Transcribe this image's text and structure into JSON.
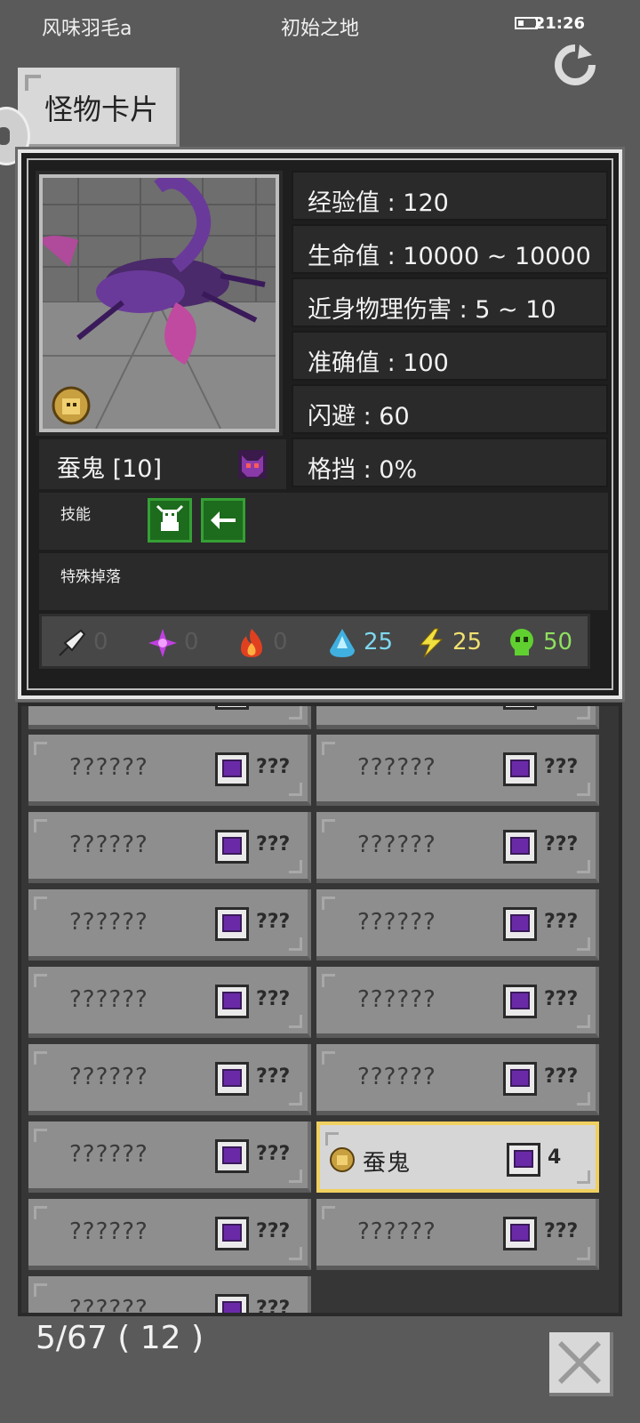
{
  "status": {
    "carrier": "风味羽毛a",
    "location": "初始之地",
    "time": "21:26"
  },
  "tab": {
    "label": "怪物卡片"
  },
  "monster": {
    "name": "蚕鬼 [10]",
    "stats": [
      "经验值 : 120",
      "生命值 : 10000 ~ 10000",
      "近身物理伤害 : 5 ~ 10",
      "准确值 : 100",
      "闪避 : 60",
      "格挡 : 0%"
    ],
    "skills_label": "技能",
    "drops_label": "特殊掉落",
    "skills": [
      "demon-skill-icon",
      "arrow-skill-icon"
    ],
    "resistances": [
      {
        "icon": "physical-resist-icon",
        "value": "0",
        "color": "#5a5a5a"
      },
      {
        "icon": "magic-resist-icon",
        "value": "0",
        "color": "#5a5a5a"
      },
      {
        "icon": "fire-resist-icon",
        "value": "0",
        "color": "#5a5a5a"
      },
      {
        "icon": "water-resist-icon",
        "value": "25",
        "color": "#7fd8f0"
      },
      {
        "icon": "lightning-resist-icon",
        "value": "25",
        "color": "#f0e070"
      },
      {
        "icon": "poison-resist-icon",
        "value": "50",
        "color": "#8fe060"
      }
    ]
  },
  "list": {
    "items": [
      {
        "name": "??????",
        "count": "???"
      },
      {
        "name": "??????",
        "count": "???"
      },
      {
        "name": "??????",
        "count": "???"
      },
      {
        "name": "??????",
        "count": "???"
      },
      {
        "name": "??????",
        "count": "???"
      },
      {
        "name": "??????",
        "count": "???"
      },
      {
        "name": "??????",
        "count": "???"
      },
      {
        "name": "??????",
        "count": "???"
      },
      {
        "name": "??????",
        "count": "???"
      },
      {
        "name": "??????",
        "count": "???"
      },
      {
        "name": "??????",
        "count": "???"
      },
      {
        "name": "蚕鬼",
        "count": "4",
        "selected": true
      },
      {
        "name": "??????",
        "count": "???"
      },
      {
        "name": "??????",
        "count": "???"
      },
      {
        "name": "??????",
        "count": "???"
      }
    ]
  },
  "footer": {
    "count_text": "5/67 ( 12 )"
  },
  "colors": {
    "selected_border": "#f0d060",
    "panel": "#1e1e1e"
  }
}
